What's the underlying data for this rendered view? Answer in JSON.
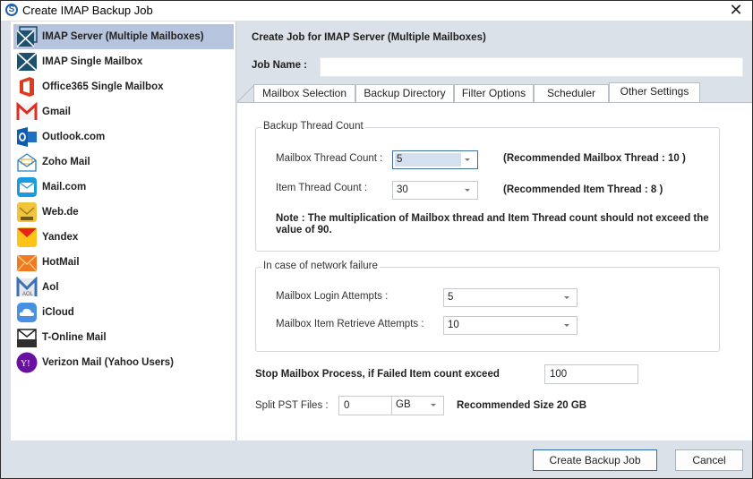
{
  "window": {
    "title": "Create IMAP Backup Job",
    "app_icon": "S",
    "close_glyph": "✕"
  },
  "sidebar": {
    "items": [
      {
        "label": "IMAP Server (Multiple Mailboxes)",
        "icon": "imap-multiple-icon",
        "selected": true
      },
      {
        "label": "IMAP Single Mailbox",
        "icon": "imap-single-icon"
      },
      {
        "label": "Office365 Single Mailbox",
        "icon": "office365-icon"
      },
      {
        "label": "Gmail",
        "icon": "gmail-icon"
      },
      {
        "label": "Outlook.com",
        "icon": "outlook-icon"
      },
      {
        "label": "Zoho Mail",
        "icon": "zoho-mail-icon"
      },
      {
        "label": "Mail.com",
        "icon": "mail-com-icon"
      },
      {
        "label": "Web.de",
        "icon": "web-de-icon"
      },
      {
        "label": "Yandex",
        "icon": "yandex-icon"
      },
      {
        "label": "HotMail",
        "icon": "hotmail-icon"
      },
      {
        "label": "Aol",
        "icon": "aol-icon"
      },
      {
        "label": "iCloud",
        "icon": "icloud-icon"
      },
      {
        "label": "T-Online Mail",
        "icon": "t-online-icon"
      },
      {
        "label": "Verizon Mail (Yahoo Users)",
        "icon": "verizon-yahoo-icon"
      }
    ]
  },
  "main": {
    "title": "Create Job for IMAP Server (Multiple Mailboxes)",
    "job_name_label": "Job Name :",
    "job_name_value": "",
    "tabs": [
      {
        "label": "Mailbox Selection"
      },
      {
        "label": "Backup Directory"
      },
      {
        "label": "Filter Options"
      },
      {
        "label": "Scheduler"
      },
      {
        "label": "Other Settings",
        "active": true
      }
    ]
  },
  "other_settings": {
    "thread_group": {
      "legend": "Backup Thread Count",
      "mailbox_thread_label": "Mailbox Thread Count :",
      "mailbox_thread_value": "5",
      "mailbox_thread_recommend": "(Recommended Mailbox Thread : 10 )",
      "item_thread_label": "Item Thread Count :",
      "item_thread_value": "30",
      "item_thread_recommend": "(Recommended Item Thread : 8 )",
      "note_line1": "Note : The multiplication of Mailbox thread  and Item Thread count should not exceed the",
      "note_line2": "value of 90."
    },
    "network_group": {
      "legend": "In case of network failure",
      "login_attempts_label": "Mailbox Login Attempts :",
      "login_attempts_value": "5",
      "retrieve_attempts_label": "Mailbox Item Retrieve Attempts :",
      "retrieve_attempts_value": "10"
    },
    "stop_process_label": "Stop Mailbox Process, if Failed Item count exceed",
    "stop_process_value": "100",
    "split_pst_label": "Split PST Files :",
    "split_pst_value": "0",
    "split_pst_unit": "GB",
    "split_pst_recommend": "Recommended Size 20 GB"
  },
  "footer": {
    "create_label": "Create Backup Job",
    "cancel_label": "Cancel"
  }
}
